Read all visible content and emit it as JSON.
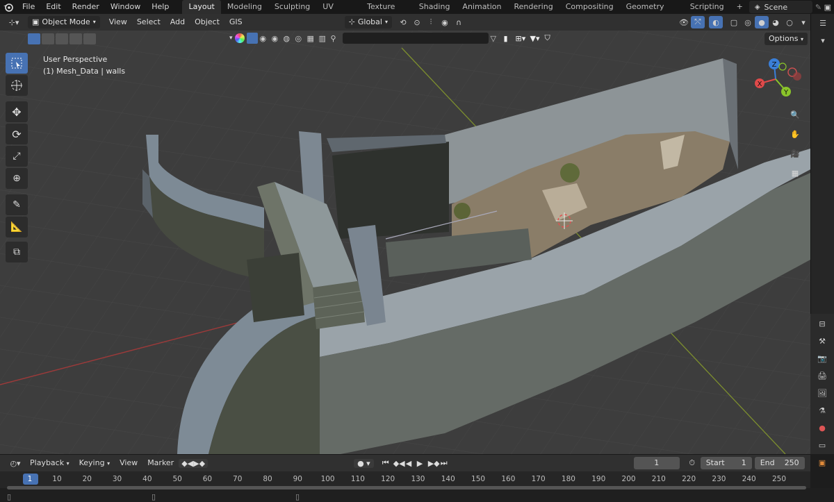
{
  "menubar": {
    "menus": [
      "File",
      "Edit",
      "Render",
      "Window",
      "Help"
    ],
    "workspaces": [
      "Layout",
      "Modeling",
      "Sculpting",
      "UV Editing",
      "Texture Paint",
      "Shading",
      "Animation",
      "Rendering",
      "Compositing",
      "Geometry Nodes",
      "Scripting"
    ],
    "active_workspace": "Layout",
    "add_tab": "+",
    "scene_name": "Scene"
  },
  "viewport_header": {
    "mode": "Object Mode",
    "menus": [
      "View",
      "Select",
      "Add",
      "Object",
      "GIS"
    ],
    "orientation": "Global",
    "options_label": "Options"
  },
  "overlay": {
    "perspective": "User Perspective",
    "object_info": "(1) Mesh_Data | walls"
  },
  "gizmo": {
    "x": "X",
    "y": "Y",
    "z": "Z"
  },
  "timeline": {
    "menus": [
      "Playback",
      "Keying",
      "View",
      "Marker"
    ],
    "current_frame": "1",
    "start_label": "Start",
    "start_value": "1",
    "end_label": "End",
    "end_value": "250",
    "ticks": [
      "1",
      "10",
      "20",
      "30",
      "40",
      "50",
      "60",
      "70",
      "80",
      "90",
      "100",
      "110",
      "120",
      "130",
      "140",
      "150",
      "160",
      "170",
      "180",
      "190",
      "200",
      "210",
      "220",
      "230",
      "240",
      "250"
    ]
  },
  "colors": {
    "accent": "#4772b3",
    "x_axis": "#e04a4a",
    "y_axis": "#8ac42a",
    "z_axis": "#3a7fd8",
    "viewport_bg": "#3d3d3d"
  }
}
